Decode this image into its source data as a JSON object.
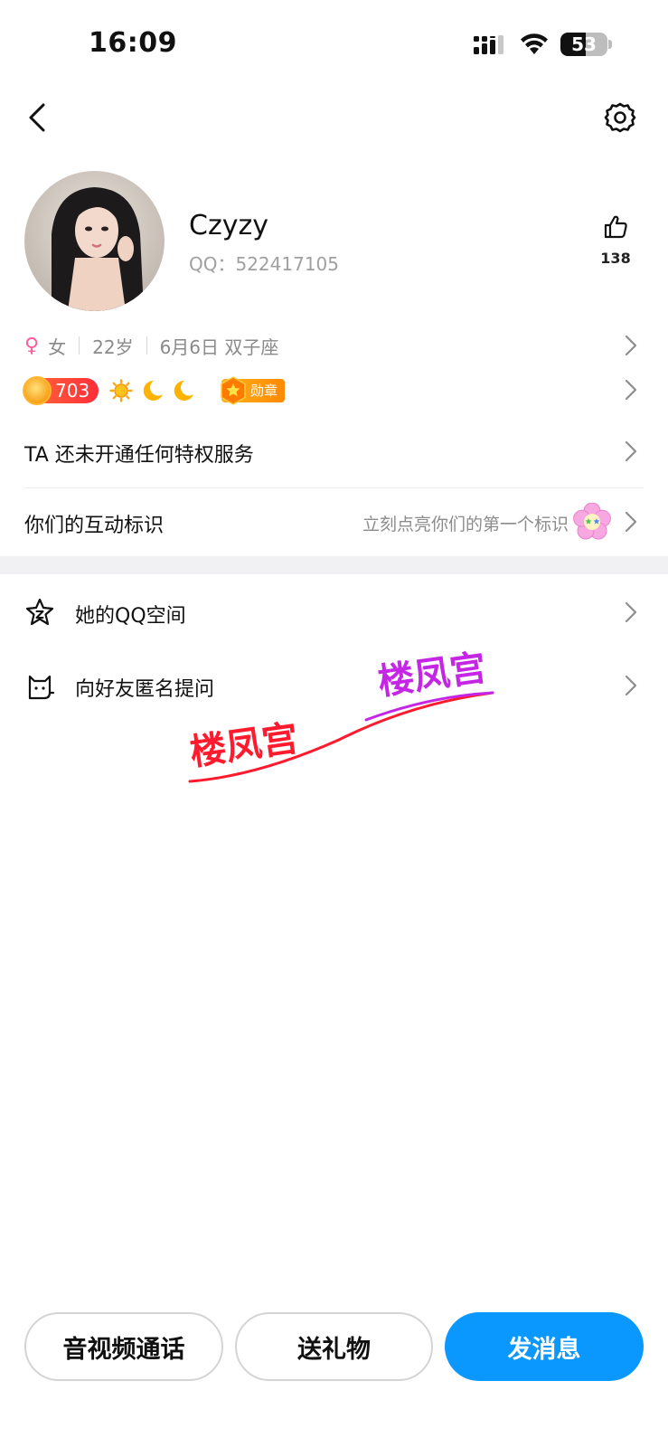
{
  "status_bar": {
    "time": "16:09",
    "battery": "53",
    "battery_level": 0.53
  },
  "profile": {
    "nickname": "Czyzy",
    "qq_line": "QQ：522417105",
    "likes": "138",
    "gender": "女",
    "age": "22岁",
    "birthday": "6月6日 双子座",
    "level": "703",
    "medal": "勋章"
  },
  "privilege": {
    "label": "TA 还未开通任何特权服务"
  },
  "interaction": {
    "label": "你们的互动标识",
    "hint": "立刻点亮你们的第一个标识"
  },
  "menu": [
    {
      "label": "她的QQ空间",
      "icon": "qzone-star-icon"
    },
    {
      "label": "向好友匿名提问",
      "icon": "cat-icon"
    }
  ],
  "watermark": {
    "text1": "楼凤宫",
    "text2": "楼凤宫"
  },
  "actions": {
    "call": "音视频通话",
    "gift": "送礼物",
    "message": "发消息"
  },
  "colors": {
    "primary": "#0a98ff",
    "female": "#ff5a9b",
    "level": "#ff2d3a",
    "medal": "#ff8a00"
  }
}
